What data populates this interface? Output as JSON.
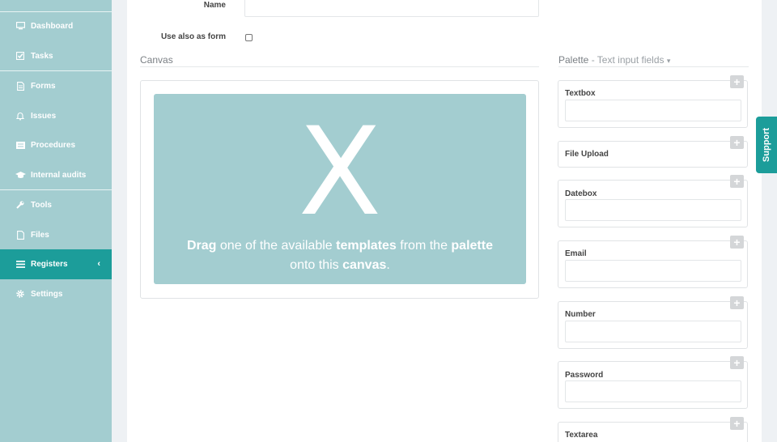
{
  "sidebar": {
    "items": [
      {
        "label": "Dashboard",
        "icon": "monitor-icon"
      },
      {
        "label": "Tasks",
        "icon": "checkbox-icon"
      },
      {
        "label": "Forms",
        "icon": "document-icon"
      },
      {
        "label": "Issues",
        "icon": "bell-icon"
      },
      {
        "label": "Procedures",
        "icon": "list-icon"
      },
      {
        "label": "Internal audits",
        "icon": "graduation-cap-icon"
      },
      {
        "label": "Tools",
        "icon": "wrench-icon"
      },
      {
        "label": "Files",
        "icon": "file-icon"
      },
      {
        "label": "Registers",
        "icon": "list-bars-icon",
        "active": true
      },
      {
        "label": "Settings",
        "icon": "gear-icon"
      }
    ]
  },
  "form": {
    "name_label": "Name",
    "name_value": "",
    "use_as_form_label": "Use also as form",
    "use_as_form_checked": false
  },
  "canvas": {
    "title": "Canvas",
    "glyph": "X",
    "text_bold_1": "Drag",
    "text_1": " one of the available ",
    "text_bold_2": "templates",
    "text_2": " from the ",
    "text_bold_3": "palette",
    "text_3": "onto this ",
    "text_bold_4": "canvas",
    "text_4": "."
  },
  "palette": {
    "title": "Palette",
    "subtitle": " - Text input fields ",
    "caret": "▾",
    "items": [
      {
        "label": "Textbox",
        "has_input": true
      },
      {
        "label": "File Upload",
        "has_input": false
      },
      {
        "label": "Datebox",
        "has_input": true
      },
      {
        "label": "Email",
        "has_input": true
      },
      {
        "label": "Number",
        "has_input": true
      },
      {
        "label": "Password",
        "has_input": true
      },
      {
        "label": "Textarea",
        "has_input": true
      }
    ],
    "add_symbol": "+"
  },
  "support": {
    "label": "Support"
  },
  "colors": {
    "sidebar": "#a3cdd0",
    "active": "#1c9d9a",
    "page_bg": "#eef1f4"
  }
}
